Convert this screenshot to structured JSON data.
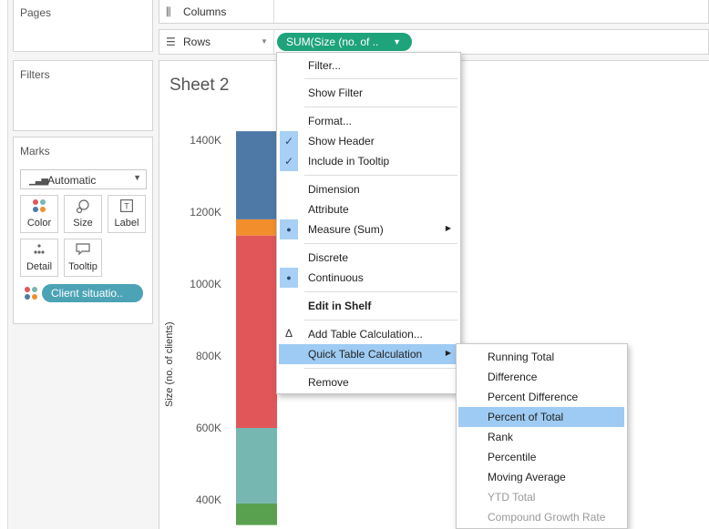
{
  "cards": {
    "pages": "Pages",
    "filters": "Filters",
    "marks": "Marks"
  },
  "marks": {
    "type": "Automatic",
    "buttons": [
      "Color",
      "Size",
      "Label",
      "Detail",
      "Tooltip"
    ],
    "pill": "Client situatio.."
  },
  "shelves": {
    "columns": "Columns",
    "rows": "Rows",
    "rows_pill": "SUM(Size (no. of .."
  },
  "sheet": {
    "title": "Sheet 2"
  },
  "chart_data": {
    "type": "bar",
    "stacked": true,
    "ylabel": "Size (no. of clients)",
    "y_ticks": [
      "1400K",
      "1200K",
      "1000K",
      "800K",
      "600K",
      "400K"
    ],
    "y_tick_values": [
      1400000,
      1200000,
      1000000,
      800000,
      600000,
      400000
    ],
    "ylim": [
      330000,
      1430000
    ],
    "segments": [
      {
        "from": 330000,
        "to": 390000,
        "color": "#59a14f"
      },
      {
        "from": 390000,
        "to": 600000,
        "color": "#76b7b2"
      },
      {
        "from": 600000,
        "to": 1135000,
        "color": "#e15759"
      },
      {
        "from": 1135000,
        "to": 1180000,
        "color": "#f28e2b"
      },
      {
        "from": 1180000,
        "to": 1425000,
        "color": "#4e79a7"
      }
    ]
  },
  "context_menu": {
    "items": [
      {
        "label": "Filter..."
      },
      {
        "label": "Show Filter"
      },
      {
        "label": "Format..."
      },
      {
        "label": "Show Header",
        "checked": true
      },
      {
        "label": "Include in Tooltip",
        "checked": true
      },
      {
        "label": "Dimension"
      },
      {
        "label": "Attribute"
      },
      {
        "label": "Measure (Sum)",
        "selected": true,
        "submenu": true
      },
      {
        "label": "Discrete"
      },
      {
        "label": "Continuous",
        "selected": true
      },
      {
        "label": "Edit in Shelf",
        "bold": true
      },
      {
        "label": "Add Table Calculation..."
      },
      {
        "label": "Quick Table Calculation",
        "submenu": true,
        "highlighted": true
      },
      {
        "label": "Remove"
      }
    ]
  },
  "quick_table_calc_menu": {
    "items": [
      {
        "label": "Running Total"
      },
      {
        "label": "Difference"
      },
      {
        "label": "Percent Difference"
      },
      {
        "label": "Percent of Total",
        "highlighted": true
      },
      {
        "label": "Rank"
      },
      {
        "label": "Percentile"
      },
      {
        "label": "Moving Average"
      },
      {
        "label": "YTD Total",
        "disabled": true
      },
      {
        "label": "Compound Growth Rate",
        "disabled": true
      }
    ]
  },
  "colors": {
    "rows_pill": "#1fa37a",
    "marks_pill": "#4ba3b5",
    "highlight": "#9ecbf3"
  }
}
